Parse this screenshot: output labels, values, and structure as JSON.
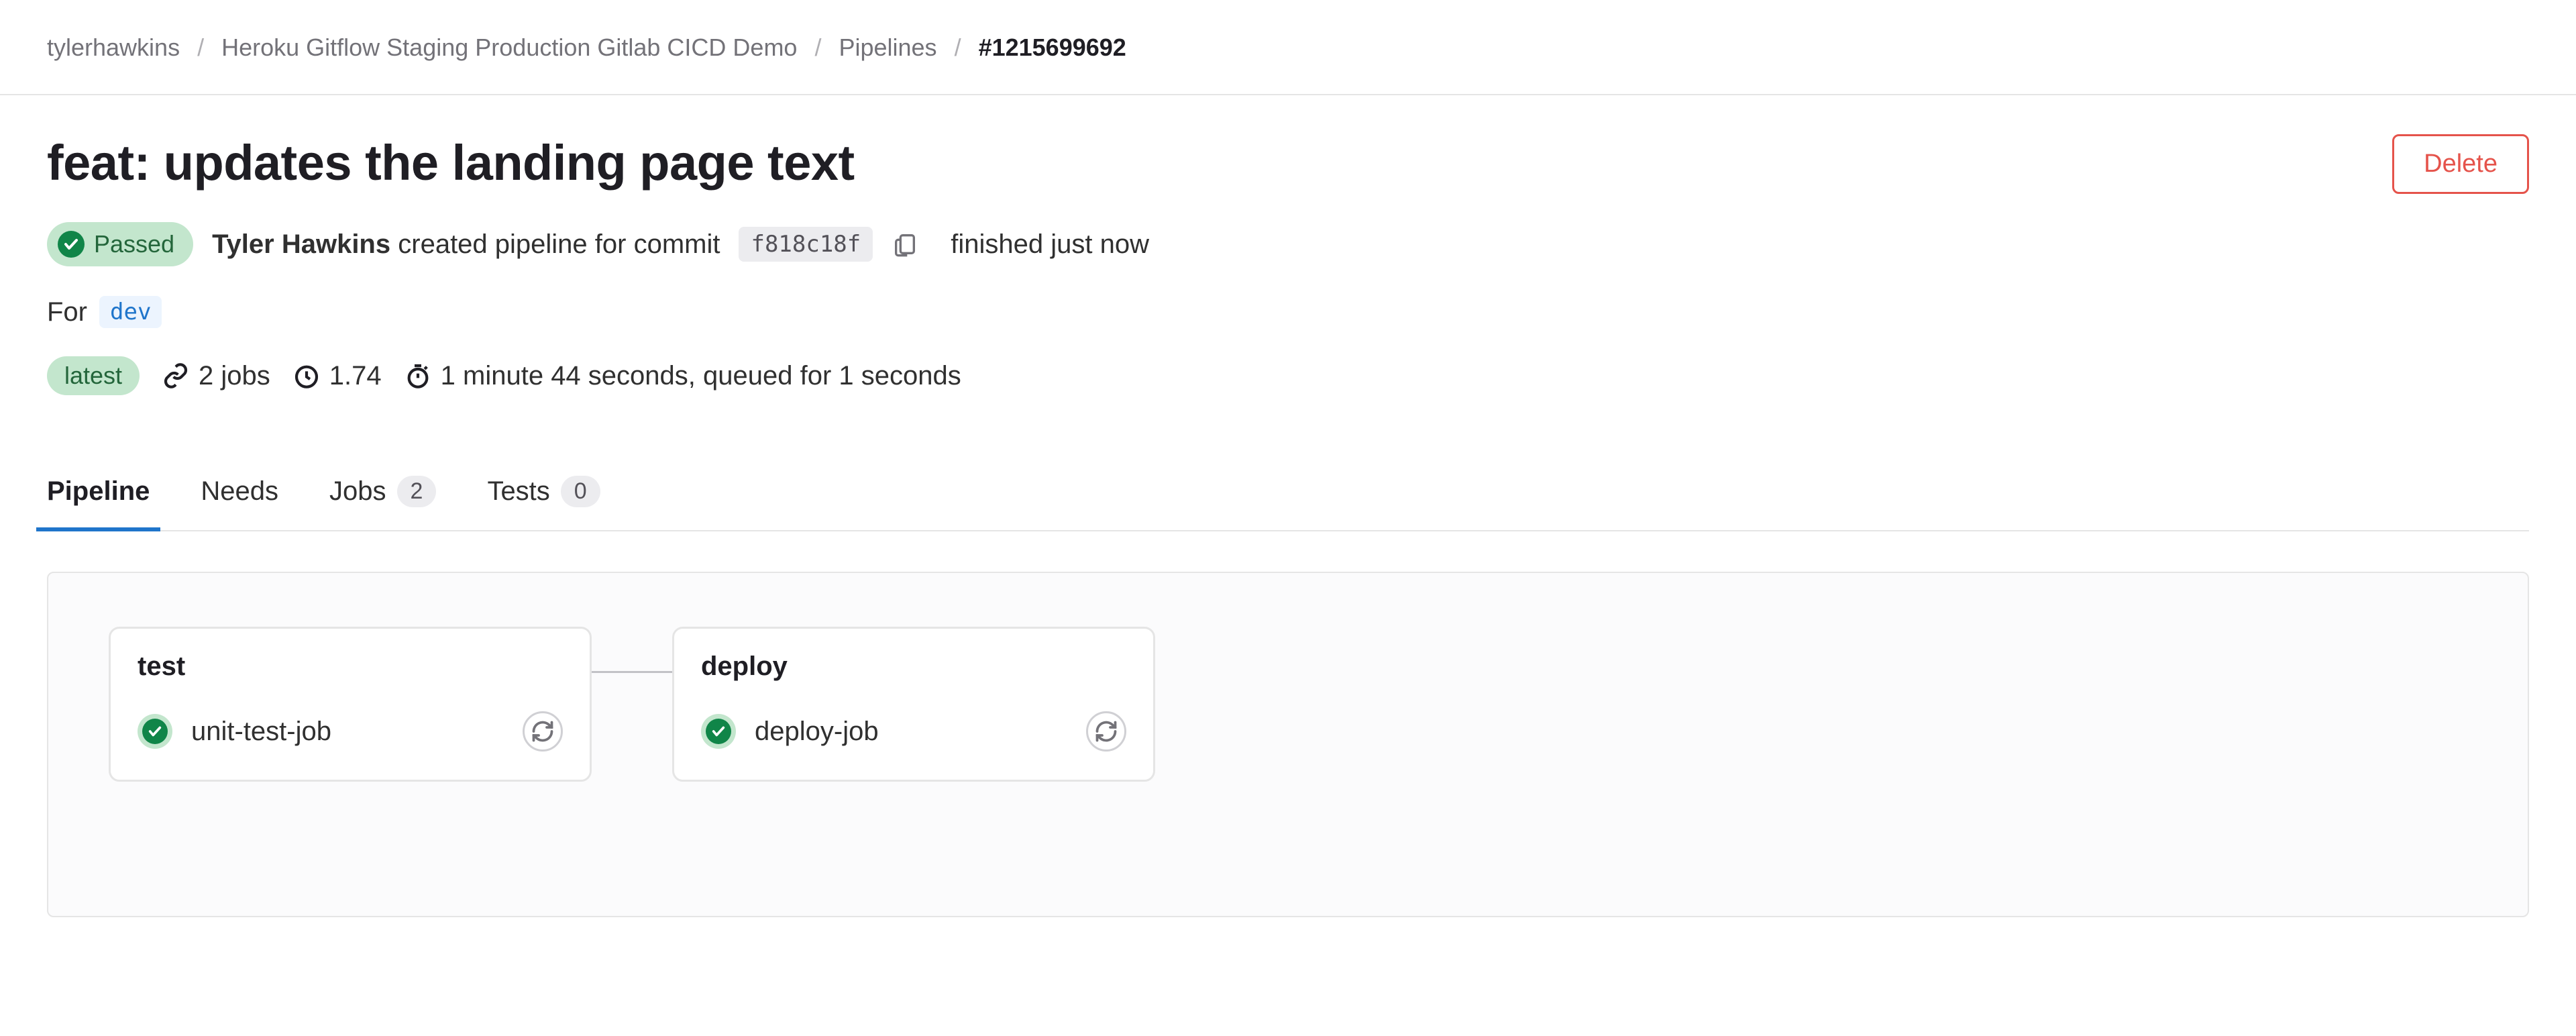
{
  "breadcrumb": {
    "items": [
      {
        "label": "tylerhawkins"
      },
      {
        "label": "Heroku Gitflow Staging Production Gitlab CICD Demo"
      },
      {
        "label": "Pipelines"
      }
    ],
    "current": "#1215699692"
  },
  "header": {
    "title": "feat: updates the landing page text",
    "delete_label": "Delete"
  },
  "status": {
    "label": "Passed"
  },
  "commit_info": {
    "author": "Tyler Hawkins",
    "action_text": "created pipeline for commit",
    "sha": "f818c18f",
    "finished_text": "finished just now"
  },
  "for_line": {
    "prefix": "For",
    "branch": "dev"
  },
  "stats": {
    "latest_label": "latest",
    "jobs": "2 jobs",
    "score": "1.74",
    "duration": "1 minute 44 seconds, queued for 1 seconds"
  },
  "tabs": [
    {
      "label": "Pipeline",
      "count": null,
      "active": true
    },
    {
      "label": "Needs",
      "count": null,
      "active": false
    },
    {
      "label": "Jobs",
      "count": "2",
      "active": false
    },
    {
      "label": "Tests",
      "count": "0",
      "active": false
    }
  ],
  "stages": [
    {
      "name": "test",
      "jobs": [
        {
          "name": "unit-test-job",
          "status": "passed"
        }
      ]
    },
    {
      "name": "deploy",
      "jobs": [
        {
          "name": "deploy-job",
          "status": "passed"
        }
      ]
    }
  ]
}
